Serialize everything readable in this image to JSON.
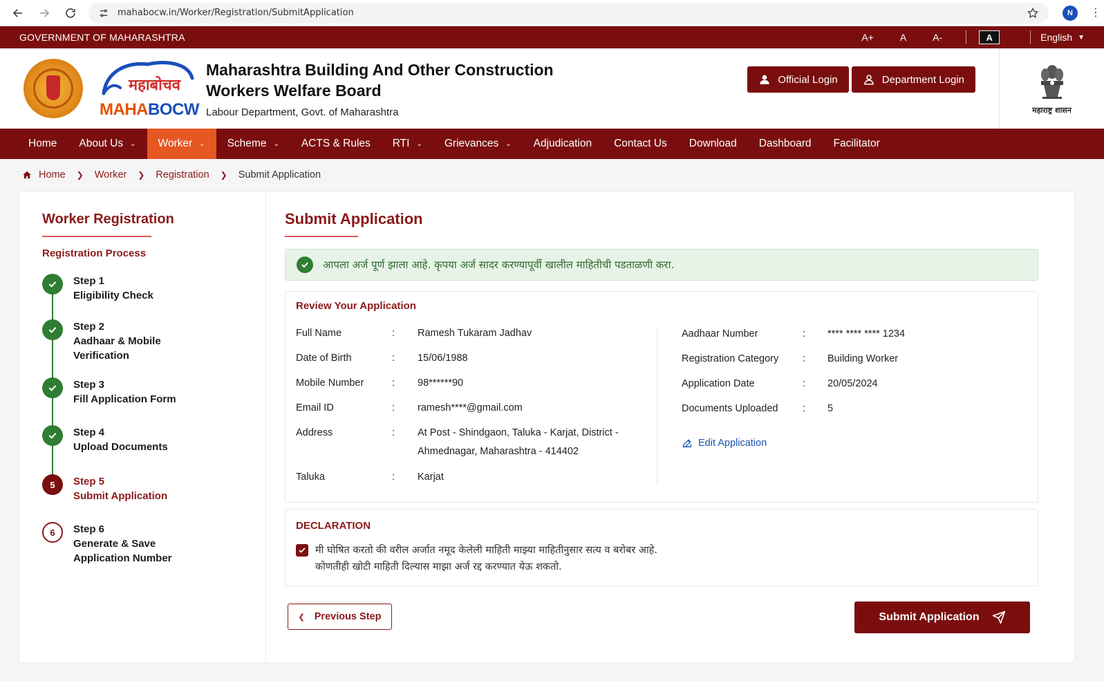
{
  "browser": {
    "url": "mahabocw.in/Worker/Registration/SubmitApplication",
    "profile_initial": "N"
  },
  "topbar": {
    "gov_title": "GOVERNMENT OF MAHARASHTRA",
    "font_increase": "A+",
    "font_normal": "A",
    "font_decrease": "A-",
    "contrast": "A",
    "language": "English"
  },
  "header": {
    "logo_deva": "महाबोचव",
    "logo_maha": "MAHA",
    "logo_bocw": "BOCW",
    "title_line1": "Maharashtra Building And Other Construction",
    "title_line2": "Workers Welfare Board",
    "subtitle": "Labour Department, Govt. of Maharashtra",
    "official_login": "Official Login",
    "department_login": "Department Login",
    "emblem_label": "महाराष्ट्र शासन"
  },
  "nav": {
    "items": [
      {
        "label": "Home",
        "dropdown": false
      },
      {
        "label": "About Us",
        "dropdown": true
      },
      {
        "label": "Worker",
        "dropdown": true,
        "active": true
      },
      {
        "label": "Scheme",
        "dropdown": true
      },
      {
        "label": "ACTS & Rules",
        "dropdown": false
      },
      {
        "label": "RTI",
        "dropdown": true
      },
      {
        "label": "Grievances",
        "dropdown": true
      },
      {
        "label": "Adjudication",
        "dropdown": false
      },
      {
        "label": "Contact Us",
        "dropdown": false
      },
      {
        "label": "Download",
        "dropdown": false
      },
      {
        "label": "Dashboard",
        "dropdown": false
      },
      {
        "label": "Facilitator",
        "dropdown": false
      }
    ]
  },
  "breadcrumb": {
    "home": "Home",
    "worker": "Worker",
    "registration": "Registration",
    "current": "Submit Application"
  },
  "sidebar": {
    "title": "Worker Registration",
    "process_label": "Registration Process",
    "steps": [
      {
        "num": "Step 1",
        "name": "Eligibility Check",
        "status": "done",
        "badge": ""
      },
      {
        "num": "Step 2",
        "name": "Aadhaar & Mobile Verification",
        "status": "done",
        "badge": ""
      },
      {
        "num": "Step 3",
        "name": "Fill Application Form",
        "status": "done",
        "badge": ""
      },
      {
        "num": "Step 4",
        "name": "Upload Documents",
        "status": "done",
        "badge": ""
      },
      {
        "num": "Step 5",
        "name": "Submit Application",
        "status": "current",
        "badge": "5"
      },
      {
        "num": "Step 6",
        "name": "Generate & Save Application Number",
        "status": "pending",
        "badge": "6"
      }
    ]
  },
  "main": {
    "title": "Submit Application",
    "alert": "आपला अर्ज पूर्ण झाला आहे. कृपया अर्ज सादर करण्यापूर्वी खालील माहितीची पडताळणी करा.",
    "review_heading": "Review Your Application",
    "left_fields": [
      {
        "label": "Full Name",
        "value": "Ramesh Tukaram Jadhav"
      },
      {
        "label": "Date of Birth",
        "value": "15/06/1988"
      },
      {
        "label": "Mobile Number",
        "value": "98******90"
      },
      {
        "label": "Email ID",
        "value": "ramesh****@gmail.com"
      },
      {
        "label": "Address",
        "value": "At Post - Shindgaon, Taluka - Karjat, District - Ahmednagar, Maharashtra - 414402"
      },
      {
        "label": "Taluka",
        "value": "Karjat"
      }
    ],
    "right_fields": [
      {
        "label": "Aadhaar Number",
        "value": "**** **** **** 1234"
      },
      {
        "label": "Registration Category",
        "value": "Building Worker"
      },
      {
        "label": "Application Date",
        "value": "20/05/2024"
      },
      {
        "label": "Documents Uploaded",
        "value": "5"
      }
    ],
    "colon": ":",
    "edit_link": "Edit Application",
    "declaration_title": "DECLARATION",
    "declaration_line1": "मी घोषित करतो की वरील अर्जात नमूद केलेली माहिती माझ्या माहितीनुसार सत्य व बरोबर आहे.",
    "declaration_line2": "कोणतीही खोटी माहिती दिल्यास माझा अर्ज रद्द करण्यात येऊ शकतो.",
    "declaration_checked": true,
    "prev_button": "Previous Step",
    "submit_button": "Submit Application"
  },
  "colors": {
    "brand_maroon": "#7a0e0e",
    "active_orange": "#e65722",
    "success_green": "#2e7d32",
    "link_blue": "#1a56b5"
  }
}
